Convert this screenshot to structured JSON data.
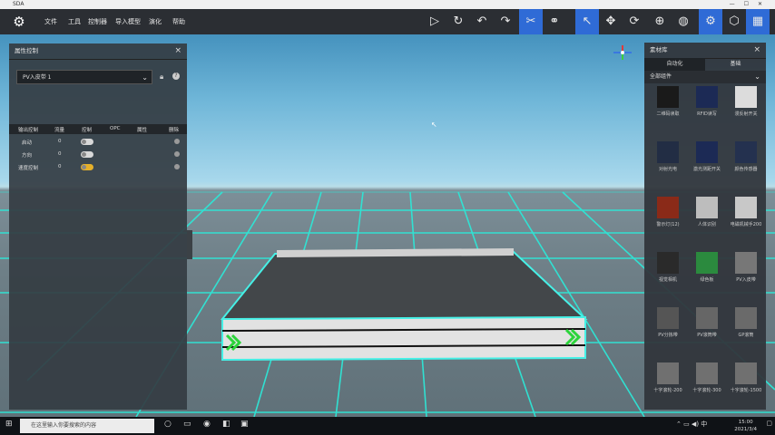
{
  "window": {
    "title": "SDA",
    "controls": [
      "—",
      "☐",
      "✕"
    ]
  },
  "menu": {
    "items": [
      "文件",
      "工具",
      "控制器",
      "导入模型",
      "演化",
      "帮助"
    ]
  },
  "toolbar": {
    "tools": [
      {
        "name": "play-icon",
        "glyph": "▷"
      },
      {
        "name": "reset-icon",
        "glyph": "↻"
      },
      {
        "name": "undo-icon",
        "glyph": "↶"
      },
      {
        "name": "redo-icon",
        "glyph": "↷"
      },
      {
        "name": "scissors-icon",
        "glyph": "✂",
        "active": true
      },
      {
        "name": "binoculars-icon",
        "glyph": "⚭"
      },
      {
        "name": "pointer-icon",
        "glyph": "↖",
        "active": true
      },
      {
        "name": "move-icon",
        "glyph": "✥"
      },
      {
        "name": "rotate-icon",
        "glyph": "⟳"
      },
      {
        "name": "target-icon",
        "glyph": "⊕"
      },
      {
        "name": "globe-icon",
        "glyph": "◍"
      },
      {
        "name": "settings-icon",
        "glyph": "⚙",
        "active": true
      },
      {
        "name": "cube-icon",
        "glyph": "⬡"
      },
      {
        "name": "grid-icon",
        "glyph": "▦",
        "active": true
      }
    ]
  },
  "left_panel": {
    "title": "属性控制",
    "dropdown_value": "PV入皮带 1",
    "columns": [
      "输出控制",
      "流量",
      "控制",
      "OPC",
      "属性",
      "删除"
    ],
    "rows": [
      {
        "name": "启动",
        "value": "0",
        "toggle_on": false
      },
      {
        "name": "方向",
        "value": "0",
        "toggle_on": false
      },
      {
        "name": "速度控制",
        "value": "0",
        "toggle_on": true
      }
    ]
  },
  "right_panel": {
    "title": "素材库",
    "tabs": [
      "自动化",
      "基础"
    ],
    "category": "全部组件",
    "items": [
      {
        "label": "二维码读取",
        "color": "#1a1a1a"
      },
      {
        "label": "RFID读写",
        "color": "#1c2a55"
      },
      {
        "label": "漫反射开关",
        "color": "#dcdcdc"
      },
      {
        "label": "对射光电",
        "color": "#222d44"
      },
      {
        "label": "激光测距开关",
        "color": "#1c2a55"
      },
      {
        "label": "颜色传感器",
        "color": "#24314f"
      },
      {
        "label": "警示灯(12)",
        "color": "#8a2a18"
      },
      {
        "label": "人体识别",
        "color": "#bdbdbd"
      },
      {
        "label": "电磁机械手200",
        "color": "#c8c8c8"
      },
      {
        "label": "视觉相机",
        "color": "#2a2a2a"
      },
      {
        "label": "绿色板",
        "color": "#2b8a3e"
      },
      {
        "label": "PV入皮带",
        "color": "#777777"
      },
      {
        "label": "PV分拣带",
        "color": "#555555"
      },
      {
        "label": "PV滚筒带",
        "color": "#666666"
      },
      {
        "label": "GP滚筒",
        "color": "#6a6a6a"
      },
      {
        "label": "十字滚轮-200",
        "color": "#707070"
      },
      {
        "label": "十字滚轮-300",
        "color": "#707070"
      },
      {
        "label": "十字滚轮-1500",
        "color": "#707070"
      }
    ]
  },
  "taskbar": {
    "search_placeholder": "在这里输入你要搜索的内容",
    "time": "15:00",
    "date": "2021/3/4"
  }
}
